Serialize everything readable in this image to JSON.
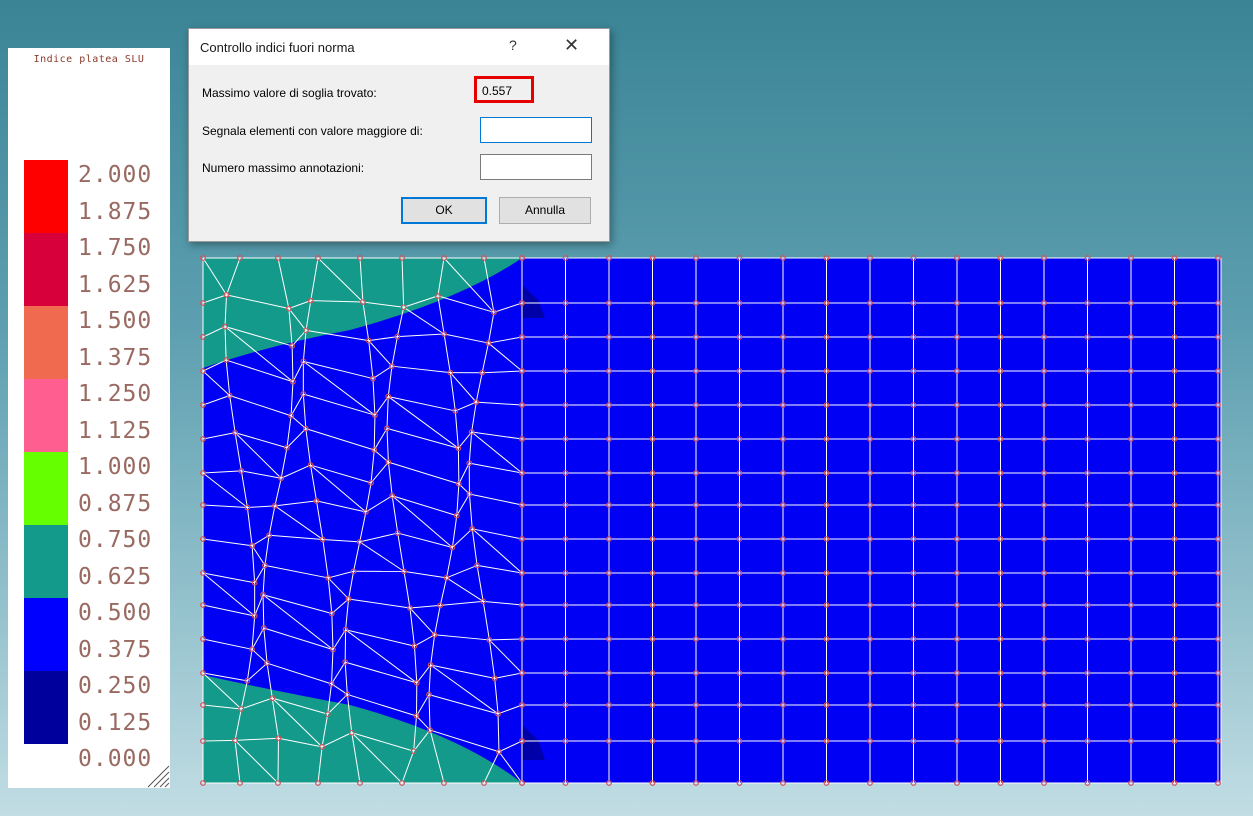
{
  "legend": {
    "title": "Indice platea SLU",
    "ticks": [
      "2.000",
      "1.875",
      "1.750",
      "1.625",
      "1.500",
      "1.375",
      "1.250",
      "1.125",
      "1.000",
      "0.875",
      "0.750",
      "0.625",
      "0.500",
      "0.375",
      "0.250",
      "0.125",
      "0.000"
    ],
    "colors": [
      "#ff0000",
      "#d8003a",
      "#f06a50",
      "#ff5f90",
      "#66ff00",
      "#139a8a",
      "#0000ff",
      "#00009c"
    ]
  },
  "plot": {
    "colors": {
      "low": "#0000f4",
      "mid": "#139a8a",
      "mesh": "#ffffff",
      "node": "#d8505a"
    }
  },
  "dialog": {
    "title": "Controllo indici fuori norma",
    "help_label": "?",
    "close_label": "✕",
    "max_label": "Massimo valore di soglia trovato:",
    "max_value": "0.557",
    "threshold_label": "Segnala elementi con valore maggiore di:",
    "threshold_value": "",
    "annotations_label": "Numero massimo annotazioni:",
    "annotations_value": "",
    "ok_label": "OK",
    "cancel_label": "Annulla",
    "highlight_color": "#e60000"
  }
}
